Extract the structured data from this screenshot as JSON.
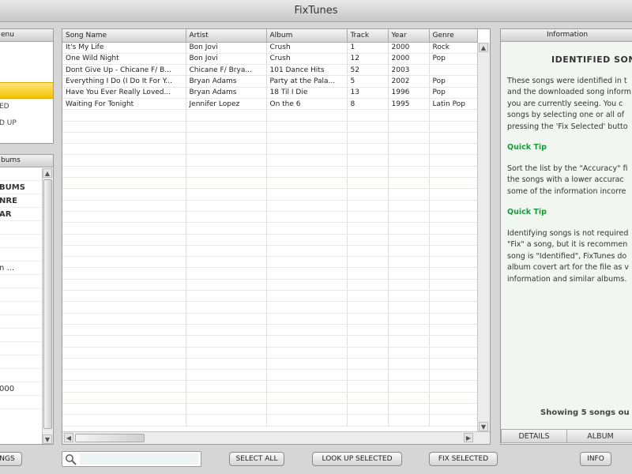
{
  "window": {
    "title": "FixTunes"
  },
  "menu": {
    "header": "enu",
    "items": [
      {
        "label": ""
      },
      {
        "label": ""
      },
      {
        "label": "",
        "selected": true
      },
      {
        "label": "ED"
      },
      {
        "label": "D UP"
      }
    ]
  },
  "albums": {
    "header": "bums",
    "items": [
      {
        "label": "",
        "bold": false
      },
      {
        "label": "BUMS",
        "bold": true
      },
      {
        "label": "NRE",
        "bold": true
      },
      {
        "label": "AR",
        "bold": true
      },
      {
        "label": "",
        "bold": false
      },
      {
        "label": "",
        "bold": false
      },
      {
        "label": "",
        "bold": false
      },
      {
        "label": "n ...",
        "bold": false
      },
      {
        "label": "",
        "bold": false
      },
      {
        "label": "",
        "bold": false
      },
      {
        "label": "",
        "bold": false
      },
      {
        "label": "",
        "bold": false
      },
      {
        "label": "",
        "bold": false
      },
      {
        "label": "",
        "bold": false
      },
      {
        "label": "",
        "bold": false
      },
      {
        "label": "",
        "bold": false
      },
      {
        "label": "000",
        "bold": false
      },
      {
        "label": "",
        "bold": false
      }
    ]
  },
  "songs": {
    "columns": [
      "Song Name",
      "Artist",
      "Album",
      "Track",
      "Year",
      "Genre"
    ],
    "rows": [
      [
        "It's My Life",
        "Bon Jovi",
        "Crush",
        "1",
        "2000",
        "Rock"
      ],
      [
        "One Wild Night",
        "Bon Jovi",
        "Crush",
        "12",
        "2000",
        "Pop"
      ],
      [
        "Dont Give Up - Chicane F/ B...",
        "Chicane F/ Brya...",
        "101 Dance Hits",
        "52",
        "2003",
        ""
      ],
      [
        "Everything I Do (I Do It For Y...",
        "Bryan Adams",
        "Party at the Pala...",
        "5",
        "2002",
        "Pop"
      ],
      [
        "Have You Ever Really Loved...",
        "Bryan Adams",
        "18 Til I Die",
        "13",
        "1996",
        "Pop"
      ],
      [
        "Waiting For Tonight",
        "Jennifer Lopez",
        "On the 6",
        "8",
        "1995",
        "Latin Pop"
      ]
    ],
    "empty_rows": 28
  },
  "info": {
    "header": "Information",
    "title": "IDENTIFIED SON",
    "para1": [
      "These songs were identified in t",
      "and the downloaded song inform",
      "you are currently seeing. You c",
      "songs by selecting one or all of",
      "pressing the 'Fix Selected' butto"
    ],
    "tip1_title": "Quick Tip",
    "para2": [
      "Sort the list by the \"Accuracy\" fi",
      "the songs with a lower accurac",
      "some of the information incorre"
    ],
    "tip2_title": "Quick Tip",
    "para3": [
      "Identifying songs is not required",
      "\"Fix\" a song, but it is recommen",
      "song is \"Identified\", FixTunes do",
      "album covert art for the file as v",
      "information and similar albums."
    ],
    "footer": "Showing 5 songs ou",
    "tabs": [
      "DETAILS",
      "ALBUM"
    ]
  },
  "toolbar": {
    "left_button": "NGS",
    "search_placeholder": "",
    "select_all": "SELECT ALL",
    "look_up_selected": "LOOK UP SELECTED",
    "fix_selected": "FIX SELECTED",
    "info": "INFO"
  }
}
